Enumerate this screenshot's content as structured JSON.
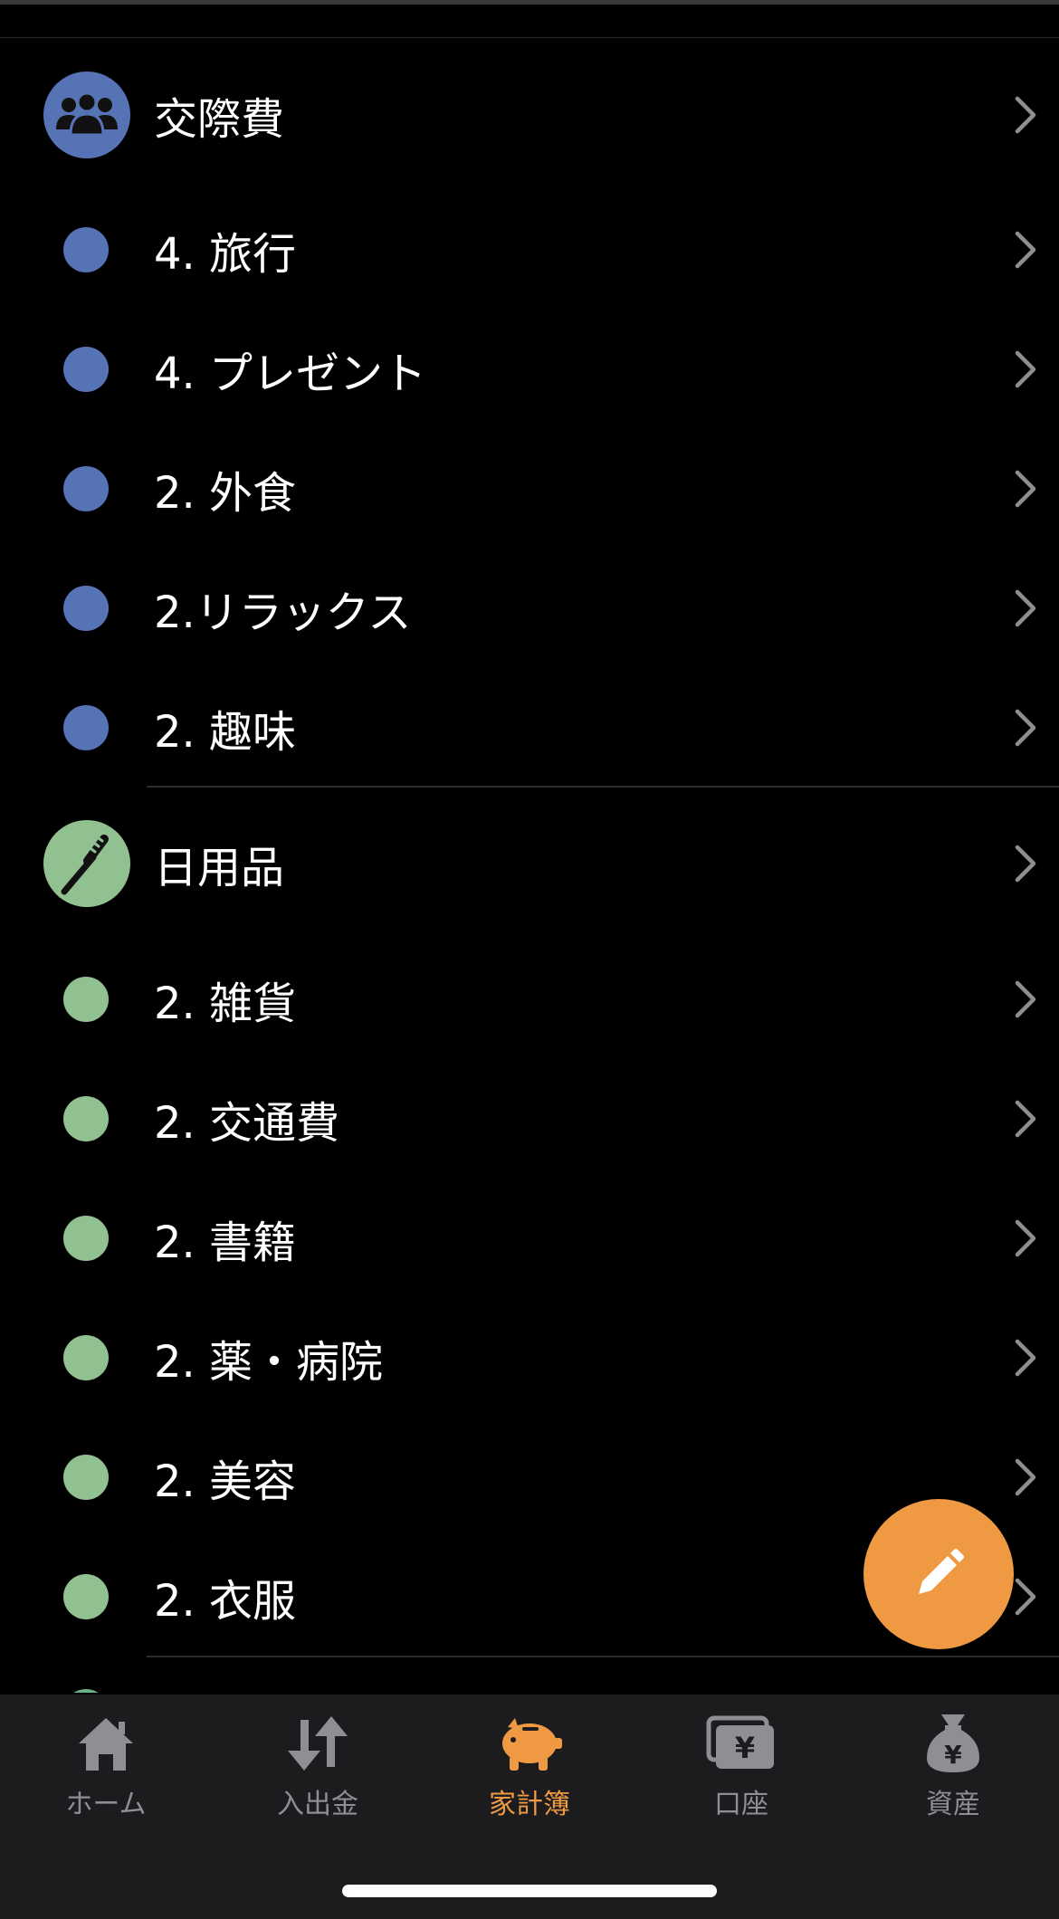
{
  "colors": {
    "social_blue": "#5673b5",
    "daily_green": "#92c191",
    "accent_orange": "#ef9a43",
    "tab_inactive": "#8e8e93"
  },
  "categories": [
    {
      "name": "交際費",
      "icon": "people-group-icon",
      "subcategories": [
        "4. 旅行",
        "4. プレゼント",
        "2. 外食",
        "2.リラックス",
        "2. 趣味"
      ]
    },
    {
      "name": "日用品",
      "icon": "toothbrush-icon",
      "subcategories": [
        "2. 雑貨",
        "2. 交通費",
        "2. 書籍",
        "2. 薬・病院",
        "2. 美容",
        "2. 衣服"
      ]
    }
  ],
  "fab": {
    "icon": "pencil-icon"
  },
  "tabs": [
    {
      "label": "ホーム",
      "icon": "home-icon",
      "active": false
    },
    {
      "label": "入出金",
      "icon": "transfer-arrows-icon",
      "active": false
    },
    {
      "label": "家計簿",
      "icon": "piggy-bank-icon",
      "active": true
    },
    {
      "label": "口座",
      "icon": "wallet-yen-icon",
      "active": false
    },
    {
      "label": "資産",
      "icon": "money-bag-yen-icon",
      "active": false
    }
  ]
}
